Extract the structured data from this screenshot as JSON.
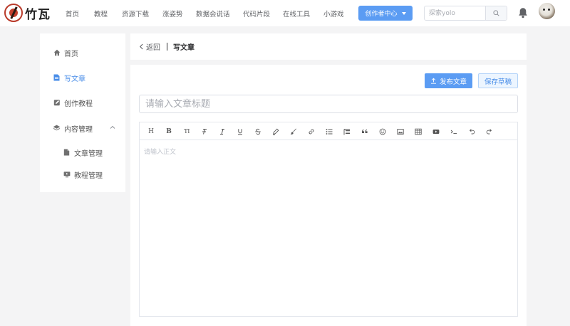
{
  "brand": {
    "name": "竹瓦"
  },
  "nav": {
    "items": [
      "首页",
      "教程",
      "资源下载",
      "涨姿势",
      "数据会说话",
      "代码片段",
      "在线工具",
      "小游戏"
    ],
    "creator_label": "创作者中心"
  },
  "search": {
    "placeholder": "探索yolo",
    "value": ""
  },
  "sidebar": {
    "items": [
      {
        "label": "首页",
        "icon": "home-icon"
      },
      {
        "label": "写文章",
        "icon": "document-edit-icon",
        "active": true
      },
      {
        "label": "创作教程",
        "icon": "edit-square-icon"
      },
      {
        "label": "内容管理",
        "icon": "layers-icon",
        "expanded": true
      },
      {
        "label": "文章管理",
        "icon": "file-icon"
      },
      {
        "label": "教程管理",
        "icon": "monitor-icon"
      }
    ]
  },
  "breadcrumb": {
    "back_label": "返回",
    "title": "写文章"
  },
  "editor": {
    "publish_label": "发布文章",
    "draft_label": "保存草稿",
    "title_placeholder": "请输入文章标题",
    "title_value": "",
    "body_placeholder": "请输入正文",
    "body_value": "",
    "toolbar": [
      "heading",
      "bold",
      "font-size",
      "strikethrough-format",
      "italic",
      "underline",
      "strikethrough",
      "marker",
      "brush",
      "link",
      "unordered-list",
      "align",
      "quote",
      "emoji",
      "image",
      "table",
      "video",
      "code",
      "undo",
      "redo"
    ]
  },
  "colors": {
    "accent": "#5b9cf3",
    "active_text": "#4a8ee8",
    "background": "#f4f4f5"
  }
}
